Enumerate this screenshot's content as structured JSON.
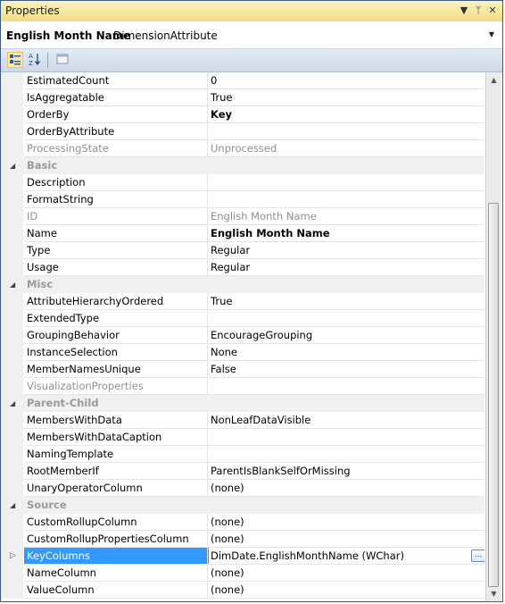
{
  "window": {
    "title": "Properties",
    "dropdown_icon": "▼",
    "pin_icon": "ᛘ",
    "close_icon": "✕"
  },
  "selector": {
    "object_name": "English Month Name",
    "object_type": "DimensionAttribute"
  },
  "toolbar": {
    "categorized_label": "categorized-view",
    "alphabetical_label": "alphabetical-sort",
    "property_pages_label": "property-pages"
  },
  "properties": [
    {
      "kind": "prop",
      "name": "EstimatedCount",
      "value": "0"
    },
    {
      "kind": "prop",
      "name": "IsAggregatable",
      "value": "True"
    },
    {
      "kind": "prop",
      "name": "OrderBy",
      "value": "Key",
      "bold": true
    },
    {
      "kind": "prop",
      "name": "OrderByAttribute",
      "value": ""
    },
    {
      "kind": "prop",
      "name": "ProcessingState",
      "value": "Unprocessed",
      "disabled": true
    },
    {
      "kind": "cat",
      "name": "Basic"
    },
    {
      "kind": "prop",
      "name": "Description",
      "value": ""
    },
    {
      "kind": "prop",
      "name": "FormatString",
      "value": ""
    },
    {
      "kind": "prop",
      "name": "ID",
      "value": "English Month Name",
      "disabled": true
    },
    {
      "kind": "prop",
      "name": "Name",
      "value": "English Month Name",
      "bold": true
    },
    {
      "kind": "prop",
      "name": "Type",
      "value": "Regular"
    },
    {
      "kind": "prop",
      "name": "Usage",
      "value": "Regular"
    },
    {
      "kind": "cat",
      "name": "Misc"
    },
    {
      "kind": "prop",
      "name": "AttributeHierarchyOrdered",
      "value": "True"
    },
    {
      "kind": "prop",
      "name": "ExtendedType",
      "value": ""
    },
    {
      "kind": "prop",
      "name": "GroupingBehavior",
      "value": "EncourageGrouping"
    },
    {
      "kind": "prop",
      "name": "InstanceSelection",
      "value": "None"
    },
    {
      "kind": "prop",
      "name": "MemberNamesUnique",
      "value": "False"
    },
    {
      "kind": "prop",
      "name": "VisualizationProperties",
      "value": "",
      "disabled": true
    },
    {
      "kind": "cat",
      "name": "Parent-Child"
    },
    {
      "kind": "prop",
      "name": "MembersWithData",
      "value": "NonLeafDataVisible"
    },
    {
      "kind": "prop",
      "name": "MembersWithDataCaption",
      "value": ""
    },
    {
      "kind": "prop",
      "name": "NamingTemplate",
      "value": ""
    },
    {
      "kind": "prop",
      "name": "RootMemberIf",
      "value": "ParentIsBlankSelfOrMissing"
    },
    {
      "kind": "prop",
      "name": "UnaryOperatorColumn",
      "value": "(none)"
    },
    {
      "kind": "cat",
      "name": "Source"
    },
    {
      "kind": "prop",
      "name": "CustomRollupColumn",
      "value": "(none)"
    },
    {
      "kind": "prop",
      "name": "CustomRollupPropertiesColumn",
      "value": "(none)"
    },
    {
      "kind": "prop",
      "name": "KeyColumns",
      "value": "DimDate.EnglishMonthName (WChar)",
      "selected": true,
      "expandable": true,
      "button": "..."
    },
    {
      "kind": "prop",
      "name": "NameColumn",
      "value": "(none)"
    },
    {
      "kind": "prop",
      "name": "ValueColumn",
      "value": "(none)"
    }
  ],
  "colors": {
    "selection": "#3399ff",
    "category_text": "#9a9a9a",
    "title_bar": "#f2dc80"
  }
}
